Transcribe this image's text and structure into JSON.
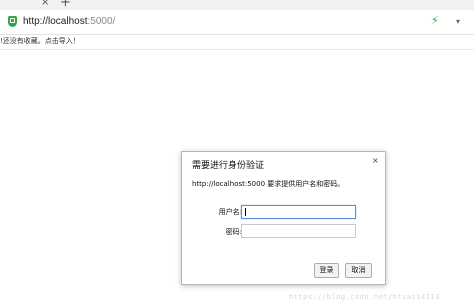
{
  "browser": {
    "tab_close_glyph": "×",
    "new_tab_glyph": "+",
    "url_host": "http://localhost",
    "url_rest": ":5000/",
    "secure_icon": "shield-icon",
    "bolt_glyph": "⚡",
    "dropdown_glyph": "▾",
    "accent_green": "#37a546"
  },
  "bookmarks": {
    "empty_text": "!还没有收藏。点击导入！"
  },
  "auth_dialog": {
    "title": "需要进行身份验证",
    "close_glyph": "×",
    "message": "http://localhost:5000 要求提供用户名和密码。",
    "username_label": "用户名:",
    "username_value": "",
    "password_label": "密码:",
    "password_value": "",
    "login_label": "登录",
    "cancel_label": "取消",
    "focus_color": "#5b8ed6"
  },
  "watermark": {
    "text": "https://blog.csdn.net/htsai14113"
  }
}
